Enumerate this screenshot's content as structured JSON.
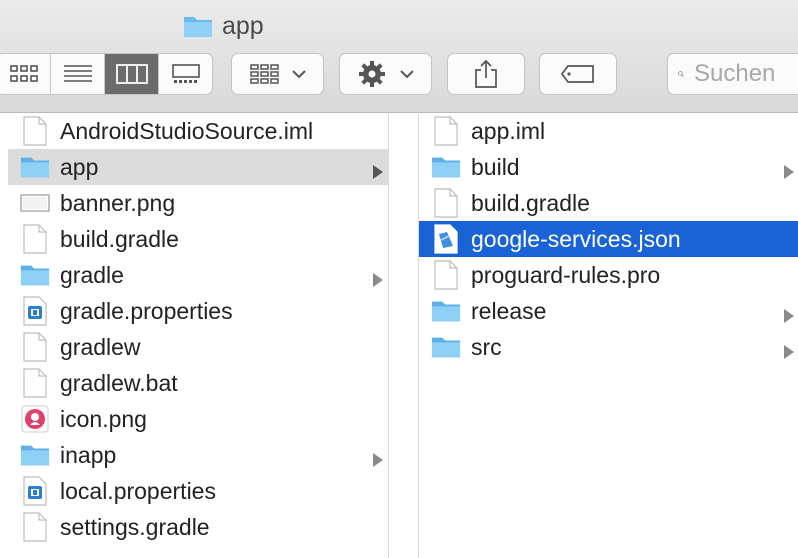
{
  "window": {
    "title": "app"
  },
  "toolbar": {
    "search_placeholder": "Suchen"
  },
  "columns": [
    {
      "items": [
        {
          "name": "AndroidStudioSource.iml",
          "kind": "doc"
        },
        {
          "name": "app",
          "kind": "folder",
          "selected": "gray",
          "has_children": true
        },
        {
          "name": "banner.png",
          "kind": "image-banner"
        },
        {
          "name": "build.gradle",
          "kind": "doc"
        },
        {
          "name": "gradle",
          "kind": "folder",
          "has_children": true
        },
        {
          "name": "gradle.properties",
          "kind": "properties"
        },
        {
          "name": "gradlew",
          "kind": "doc"
        },
        {
          "name": "gradlew.bat",
          "kind": "doc"
        },
        {
          "name": "icon.png",
          "kind": "image-icon"
        },
        {
          "name": "inapp",
          "kind": "folder",
          "has_children": true
        },
        {
          "name": "local.properties",
          "kind": "properties"
        },
        {
          "name": "settings.gradle",
          "kind": "doc"
        }
      ]
    },
    {
      "items": [
        {
          "name": "app.iml",
          "kind": "doc"
        },
        {
          "name": "build",
          "kind": "folder",
          "has_children": true
        },
        {
          "name": "build.gradle",
          "kind": "doc"
        },
        {
          "name": "google-services.json",
          "kind": "json",
          "selected": "blue"
        },
        {
          "name": "proguard-rules.pro",
          "kind": "doc"
        },
        {
          "name": "release",
          "kind": "folder",
          "has_children": true
        },
        {
          "name": "src",
          "kind": "folder",
          "has_children": true
        }
      ]
    }
  ],
  "colors": {
    "selection_blue": "#1a63d6",
    "selection_gray": "#dcdcdc",
    "folder": "#76c3f2"
  }
}
